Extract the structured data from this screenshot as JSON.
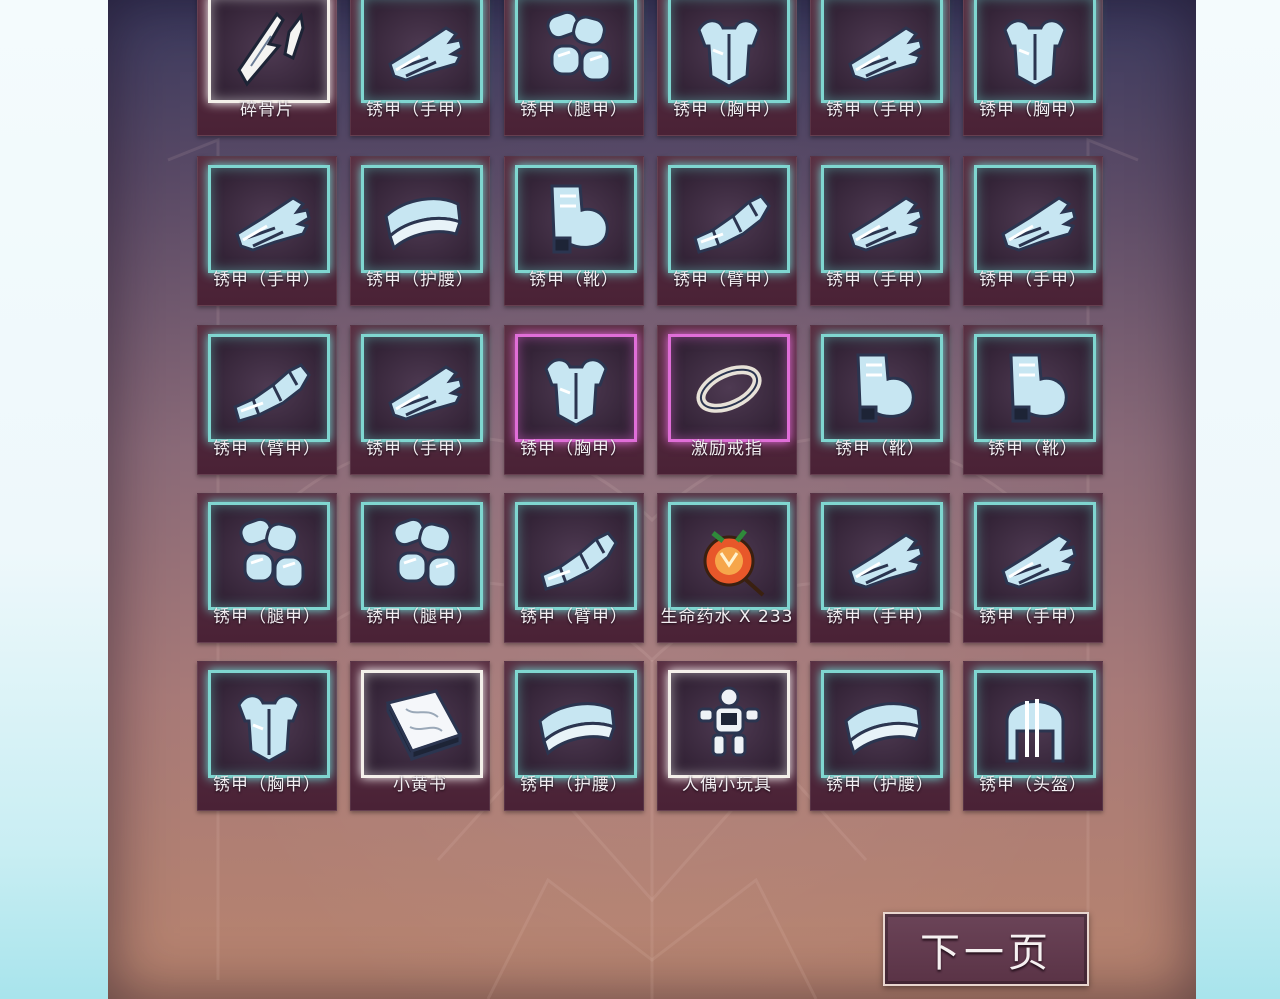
{
  "inventory": {
    "rows": [
      [
        {
          "name": "碎骨片",
          "icon": "bone-shard-icon",
          "frame": "white"
        },
        {
          "name": "锈甲（手甲）",
          "icon": "gauntlet-icon",
          "frame": "cyan"
        },
        {
          "name": "锈甲（腿甲）",
          "icon": "leg-armor-icon",
          "frame": "cyan"
        },
        {
          "name": "锈甲（胸甲）",
          "icon": "chest-armor-icon",
          "frame": "cyan"
        },
        {
          "name": "锈甲（手甲）",
          "icon": "gauntlet-icon",
          "frame": "cyan"
        },
        {
          "name": "锈甲（胸甲）",
          "icon": "chest-armor-icon",
          "frame": "cyan"
        }
      ],
      [
        {
          "name": "锈甲（手甲）",
          "icon": "gauntlet-icon",
          "frame": "cyan"
        },
        {
          "name": "锈甲（护腰）",
          "icon": "belt-armor-icon",
          "frame": "cyan"
        },
        {
          "name": "锈甲（靴）",
          "icon": "boot-icon",
          "frame": "cyan"
        },
        {
          "name": "锈甲（臂甲）",
          "icon": "arm-armor-icon",
          "frame": "cyan"
        },
        {
          "name": "锈甲（手甲）",
          "icon": "gauntlet-icon",
          "frame": "cyan"
        },
        {
          "name": "锈甲（手甲）",
          "icon": "gauntlet-icon",
          "frame": "cyan"
        }
      ],
      [
        {
          "name": "锈甲（臂甲）",
          "icon": "arm-armor-icon",
          "frame": "cyan"
        },
        {
          "name": "锈甲（手甲）",
          "icon": "gauntlet-icon",
          "frame": "cyan"
        },
        {
          "name": "锈甲（胸甲）",
          "icon": "chest-armor-icon",
          "frame": "purple"
        },
        {
          "name": "激励戒指",
          "icon": "ring-icon",
          "frame": "purple"
        },
        {
          "name": "锈甲（靴）",
          "icon": "boot-icon",
          "frame": "cyan"
        },
        {
          "name": "锈甲（靴）",
          "icon": "boot-icon",
          "frame": "cyan"
        }
      ],
      [
        {
          "name": "锈甲（腿甲）",
          "icon": "leg-armor-icon",
          "frame": "cyan"
        },
        {
          "name": "锈甲（腿甲）",
          "icon": "leg-armor-icon",
          "frame": "cyan"
        },
        {
          "name": "锈甲（臂甲）",
          "icon": "arm-armor-icon",
          "frame": "cyan"
        },
        {
          "name": "生命药水 X 233",
          "icon": "health-potion-icon",
          "frame": "cyan"
        },
        {
          "name": "锈甲（手甲）",
          "icon": "gauntlet-icon",
          "frame": "cyan"
        },
        {
          "name": "锈甲（手甲）",
          "icon": "gauntlet-icon",
          "frame": "cyan"
        }
      ],
      [
        {
          "name": "锈甲（胸甲）",
          "icon": "chest-armor-icon",
          "frame": "cyan"
        },
        {
          "name": "小黄书",
          "icon": "book-icon",
          "frame": "white"
        },
        {
          "name": "锈甲（护腰）",
          "icon": "belt-armor-icon",
          "frame": "cyan"
        },
        {
          "name": "人偶小玩具",
          "icon": "doll-toy-icon",
          "frame": "white"
        },
        {
          "name": "锈甲（护腰）",
          "icon": "belt-armor-icon",
          "frame": "cyan"
        },
        {
          "name": "锈甲（头盔）",
          "icon": "helmet-icon",
          "frame": "cyan"
        }
      ]
    ]
  },
  "next_page_label": "下一页"
}
